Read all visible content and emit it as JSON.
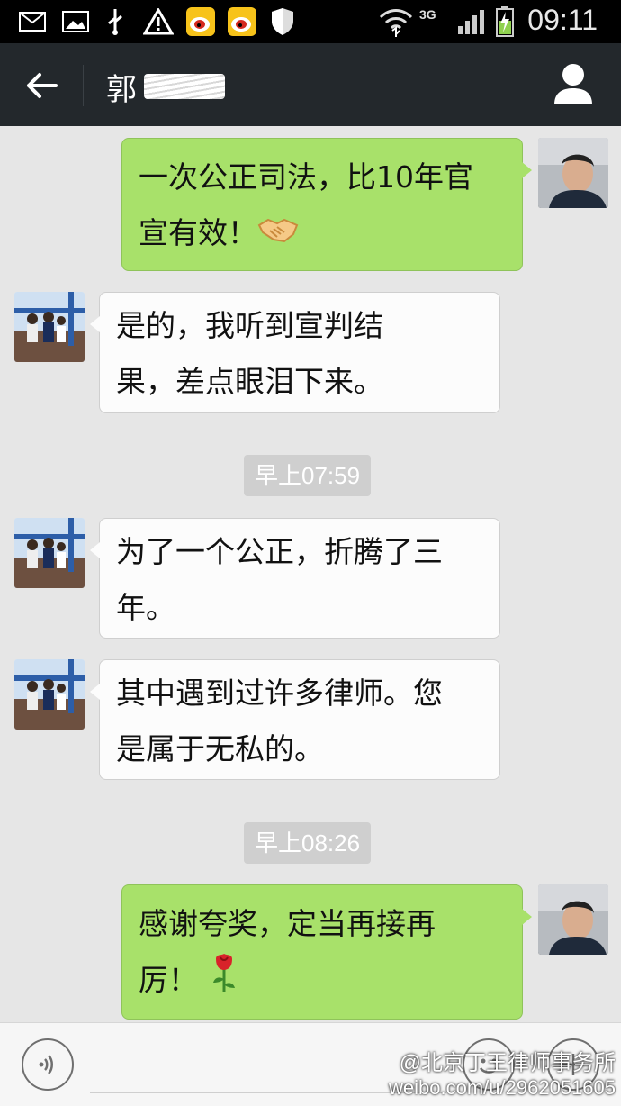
{
  "status_bar": {
    "network": "3G",
    "time": "09:11",
    "icons": [
      "mail-icon",
      "image-icon",
      "usb-icon",
      "warning-icon",
      "weibo-icon",
      "weibo-icon",
      "shield-icon",
      "wifi-icon",
      "signal-icon",
      "battery-icon"
    ]
  },
  "header": {
    "title": "郭",
    "back_icon": "arrow-left-icon",
    "profile_icon": "person-icon"
  },
  "messages": [
    {
      "side": "me",
      "lines": [
        "一次公正司法，比10年官",
        "宣有效！"
      ],
      "emoji": "handshake"
    },
    {
      "side": "them",
      "lines": [
        "是的，我听到宣判结",
        "果，差点眼泪下来。"
      ]
    },
    {
      "type": "time",
      "text": "早上07:59"
    },
    {
      "side": "them",
      "lines": [
        "为了一个公正，折腾了三",
        "年。"
      ]
    },
    {
      "side": "them",
      "lines": [
        "其中遇到过许多律师。您",
        "是属于无私的。"
      ]
    },
    {
      "type": "time",
      "text": "早上08:26"
    },
    {
      "side": "me",
      "lines": [
        "感谢夸奖，定当再接再",
        "厉！"
      ],
      "emoji": "rose"
    }
  ],
  "input_bar": {
    "voice_icon": "voice-icon",
    "emoji_icon": "smiley-icon",
    "add_icon": "plus-icon"
  },
  "watermark": {
    "line1": "@北京丁王律师事务所",
    "line2": "weibo.com/u/2962051605"
  }
}
